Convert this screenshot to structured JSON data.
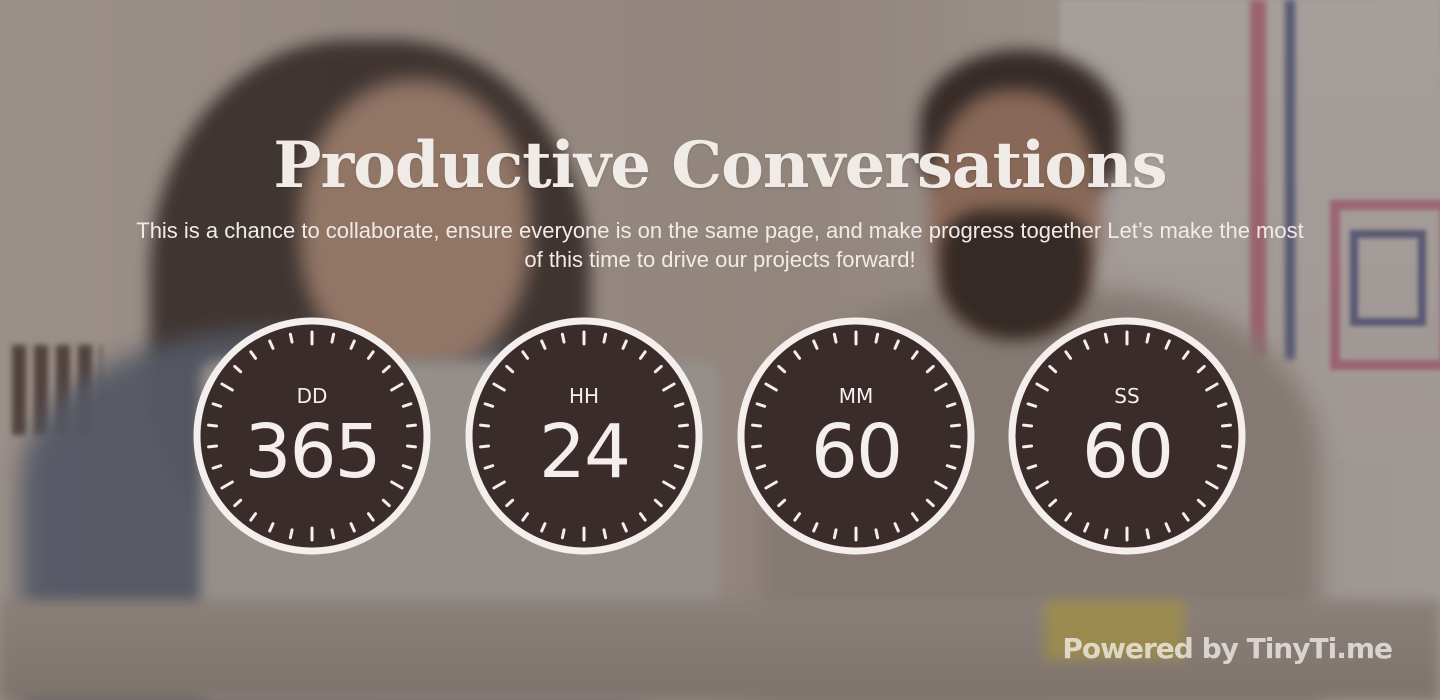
{
  "header": {
    "title": "Productive Conversations",
    "subtitle": "This is a chance to collaborate, ensure everyone is on the same page, and make progress together Let’s make the most of this time to drive our projects forward!"
  },
  "countdown": {
    "units": [
      {
        "label": "DD",
        "value": "365"
      },
      {
        "label": "HH",
        "value": "24"
      },
      {
        "label": "MM",
        "value": "60"
      },
      {
        "label": "SS",
        "value": "60"
      }
    ],
    "dial_color": "#3a2c2a",
    "ring_color": "#f4efec"
  },
  "footer": {
    "powered_by": "Powered by TinyTi.me"
  }
}
